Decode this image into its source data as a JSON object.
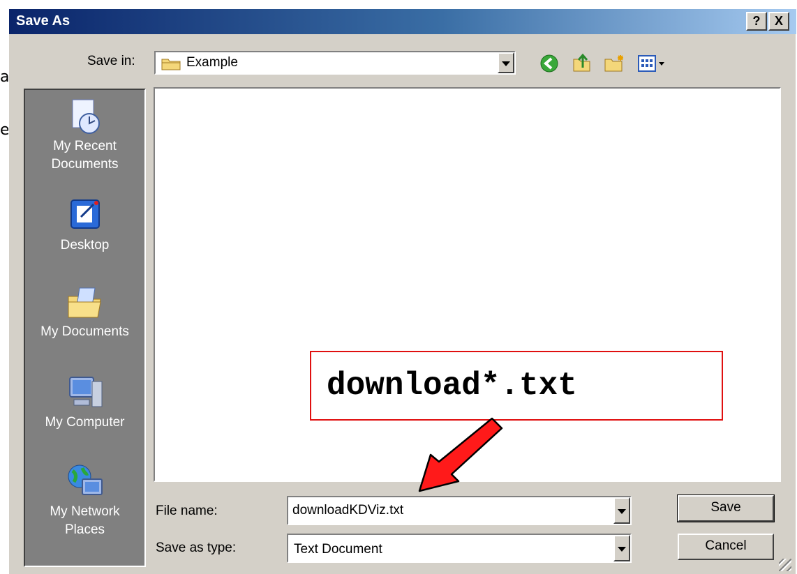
{
  "background_text": {
    "line1": "a|",
    "line2": "e"
  },
  "dialog": {
    "title": "Save As",
    "help_label": "?",
    "close_label": "X"
  },
  "toolbar": {
    "save_in_label": "Save in:",
    "save_in_value": "Example",
    "icons": [
      "back-icon",
      "up-folder-icon",
      "new-folder-icon",
      "view-menu-icon"
    ]
  },
  "places": [
    {
      "label": "My Recent Documents",
      "line1": "My Recent",
      "line2": "Documents",
      "icon": "recent-documents-icon"
    },
    {
      "label": "Desktop",
      "icon": "desktop-icon"
    },
    {
      "label": "My Documents",
      "icon": "my-documents-icon"
    },
    {
      "label": "My Computer",
      "icon": "my-computer-icon"
    },
    {
      "label": "My Network Places",
      "line1": "My Network",
      "line2": "Places",
      "icon": "network-places-icon"
    }
  ],
  "form": {
    "file_name_label": "File name:",
    "file_name_value": "downloadKDViz.txt",
    "save_type_label": "Save as type:",
    "save_type_value": "Text Document",
    "save_button": "Save",
    "cancel_button": "Cancel"
  },
  "callout": {
    "text": "download*.txt",
    "color": "#e01010"
  },
  "colors": {
    "title_start": "#0a246a",
    "title_end": "#a6caf0",
    "face": "#d4d0c8",
    "places_bg": "#808080"
  }
}
